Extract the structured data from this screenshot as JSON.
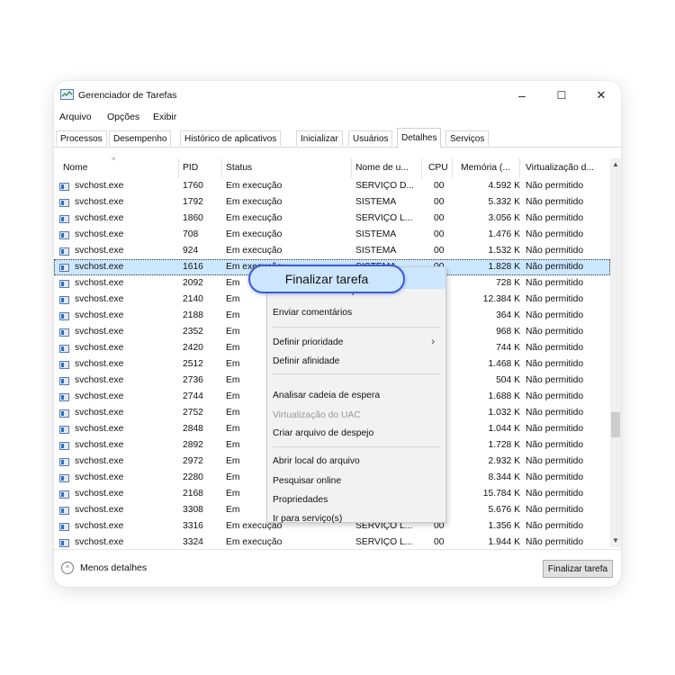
{
  "window": {
    "title": "Gerenciador de Tarefas",
    "controls": {
      "minimize": "–",
      "maximize": "☐",
      "close": "✕"
    }
  },
  "menu": [
    "Arquivo",
    "Opções",
    "Exibir"
  ],
  "tabs": [
    "Processos",
    "Desempenho",
    "Histórico de aplicativos",
    "Inicializar",
    "Usuários",
    "Detalhes",
    "Serviços"
  ],
  "active_tab": "Detalhes",
  "columns": [
    "Nome",
    "PID",
    "Status",
    "Nome de u...",
    "CPU",
    "Memória (...",
    "Virtualização d..."
  ],
  "rows": [
    {
      "name": "svchost.exe",
      "pid": "1760",
      "status": "Em execução",
      "user": "SERVIÇO D...",
      "cpu": "00",
      "mem": "4.592 K",
      "virt": "Não permitido"
    },
    {
      "name": "svchost.exe",
      "pid": "1792",
      "status": "Em execução",
      "user": "SISTEMA",
      "cpu": "00",
      "mem": "5.332 K",
      "virt": "Não permitido"
    },
    {
      "name": "svchost.exe",
      "pid": "1860",
      "status": "Em execução",
      "user": "SERVIÇO L...",
      "cpu": "00",
      "mem": "3.056 K",
      "virt": "Não permitido"
    },
    {
      "name": "svchost.exe",
      "pid": "708",
      "status": "Em execução",
      "user": "SISTEMA",
      "cpu": "00",
      "mem": "1.476 K",
      "virt": "Não permitido"
    },
    {
      "name": "svchost.exe",
      "pid": "924",
      "status": "Em execução",
      "user": "SISTEMA",
      "cpu": "00",
      "mem": "1.532 K",
      "virt": "Não permitido"
    },
    {
      "name": "svchost.exe",
      "pid": "1616",
      "status": "Em execução",
      "user": "SISTEMA",
      "cpu": "00",
      "mem": "1.828 K",
      "virt": "Não permitido",
      "selected": true
    },
    {
      "name": "svchost.exe",
      "pid": "2092",
      "status": "Em",
      "user": "",
      "cpu": "",
      "mem": "728 K",
      "virt": "Não permitido"
    },
    {
      "name": "svchost.exe",
      "pid": "2140",
      "status": "Em",
      "user": "",
      "cpu": "",
      "mem": "12.384 K",
      "virt": "Não permitido"
    },
    {
      "name": "svchost.exe",
      "pid": "2188",
      "status": "Em",
      "user": "",
      "cpu": "",
      "mem": "364 K",
      "virt": "Não permitido"
    },
    {
      "name": "svchost.exe",
      "pid": "2352",
      "status": "Em",
      "user": "",
      "cpu": "",
      "mem": "968 K",
      "virt": "Não permitido"
    },
    {
      "name": "svchost.exe",
      "pid": "2420",
      "status": "Em",
      "user": "",
      "cpu": "",
      "mem": "744 K",
      "virt": "Não permitido"
    },
    {
      "name": "svchost.exe",
      "pid": "2512",
      "status": "Em",
      "user": "",
      "cpu": "",
      "mem": "1.468 K",
      "virt": "Não permitido"
    },
    {
      "name": "svchost.exe",
      "pid": "2736",
      "status": "Em",
      "user": "",
      "cpu": "",
      "mem": "504 K",
      "virt": "Não permitido"
    },
    {
      "name": "svchost.exe",
      "pid": "2744",
      "status": "Em",
      "user": "",
      "cpu": "",
      "mem": "1.688 K",
      "virt": "Não permitido"
    },
    {
      "name": "svchost.exe",
      "pid": "2752",
      "status": "Em",
      "user": "",
      "cpu": "",
      "mem": "1.032 K",
      "virt": "Não permitido"
    },
    {
      "name": "svchost.exe",
      "pid": "2848",
      "status": "Em",
      "user": "",
      "cpu": "",
      "mem": "1.044 K",
      "virt": "Não permitido"
    },
    {
      "name": "svchost.exe",
      "pid": "2892",
      "status": "Em",
      "user": "",
      "cpu": "",
      "mem": "1.728 K",
      "virt": "Não permitido"
    },
    {
      "name": "svchost.exe",
      "pid": "2972",
      "status": "Em",
      "user": "",
      "cpu": "",
      "mem": "2.932 K",
      "virt": "Não permitido"
    },
    {
      "name": "svchost.exe",
      "pid": "2280",
      "status": "Em",
      "user": "",
      "cpu": "",
      "mem": "8.344 K",
      "virt": "Não permitido"
    },
    {
      "name": "svchost.exe",
      "pid": "2168",
      "status": "Em",
      "user": "",
      "cpu": "",
      "mem": "15.784 K",
      "virt": "Não permitido"
    },
    {
      "name": "svchost.exe",
      "pid": "3308",
      "status": "Em",
      "user": "",
      "cpu": "",
      "mem": "5.676 K",
      "virt": "Não permitido"
    },
    {
      "name": "svchost.exe",
      "pid": "3316",
      "status": "Em execução",
      "user": "SERVIÇO L...",
      "cpu": "00",
      "mem": "1.356 K",
      "virt": "Não permitido"
    },
    {
      "name": "svchost.exe",
      "pid": "3324",
      "status": "Em execução",
      "user": "SERVIÇO L...",
      "cpu": "00",
      "mem": "1.944 K",
      "virt": "Não permitido"
    }
  ],
  "context_menu": {
    "highlighted": "Finalizar tarefa",
    "items": [
      {
        "label": "Finalizar árvore de processos"
      },
      {
        "label": "Enviar comentários"
      },
      {
        "sep": true
      },
      {
        "label": "Definir prioridade",
        "submenu": true
      },
      {
        "label": "Definir afinidade"
      },
      {
        "sep": true
      },
      {
        "label": "Analisar cadeia de espera"
      },
      {
        "label": "Virtualização do UAC",
        "disabled": true
      },
      {
        "label": "Criar arquivo de despejo"
      },
      {
        "sep": true
      },
      {
        "label": "Abrir local do arquivo"
      },
      {
        "label": "Pesquisar online"
      },
      {
        "label": "Propriedades"
      },
      {
        "label": "Ir para serviço(s)"
      }
    ]
  },
  "footer": {
    "less_details": "Menos detalhes",
    "end_task": "Finalizar tarefa"
  },
  "icons": {
    "sort": "chevron-up-icon",
    "less": "chevron-up-circle-icon",
    "process": "window-icon"
  }
}
